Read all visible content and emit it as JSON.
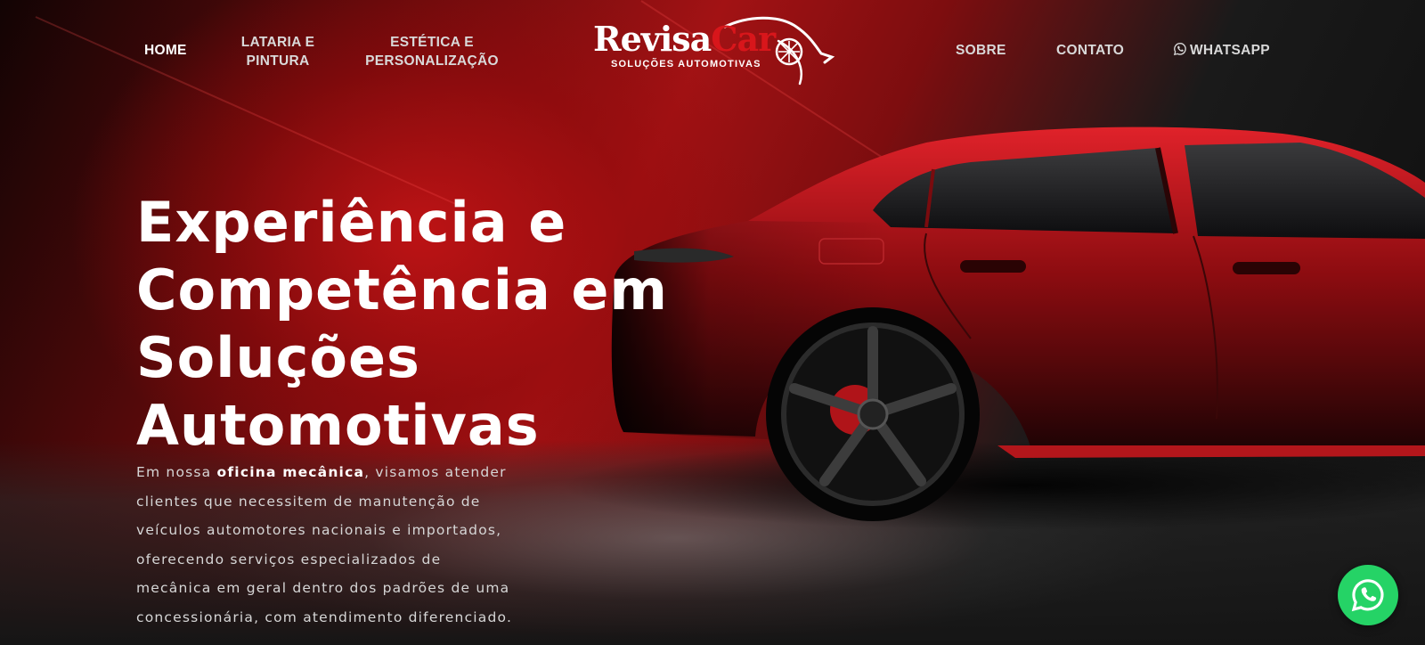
{
  "nav": {
    "home": "HOME",
    "lataria_line1": "LATARIA E",
    "lataria_line2": "PINTURA",
    "estetica_line1": "ESTÉTICA E",
    "estetica_line2": "PERSONALIZAÇÃO",
    "sobre": "SOBRE",
    "contato": "CONTATO",
    "whatsapp": "WHATSAPP"
  },
  "logo": {
    "part1": "Revisa",
    "part2": "Car",
    "tagline": "SOLUÇÕES AUTOMOTIVAS"
  },
  "hero": {
    "headline_line1": "Experiência e",
    "headline_line2": "Competência em Soluções",
    "headline_line3": "Automotivas",
    "intro_before": "Em nossa ",
    "intro_bold": "oficina mecânica",
    "intro_after": ", visamos atender clientes que necessitem de manutenção de veículos automotores nacionais e importados, oferecendo serviços especializados de mecânica em geral dentro dos padrões de uma concessionária, com atendimento diferenciado."
  },
  "icons": {
    "nav_whatsapp": "whatsapp-icon",
    "floating": "whatsapp-icon",
    "logo_wheel": "wheel-icon"
  },
  "colors": {
    "brand_red": "#d8161b",
    "whatsapp_green": "#25d366",
    "background": "#0a0a0a"
  }
}
